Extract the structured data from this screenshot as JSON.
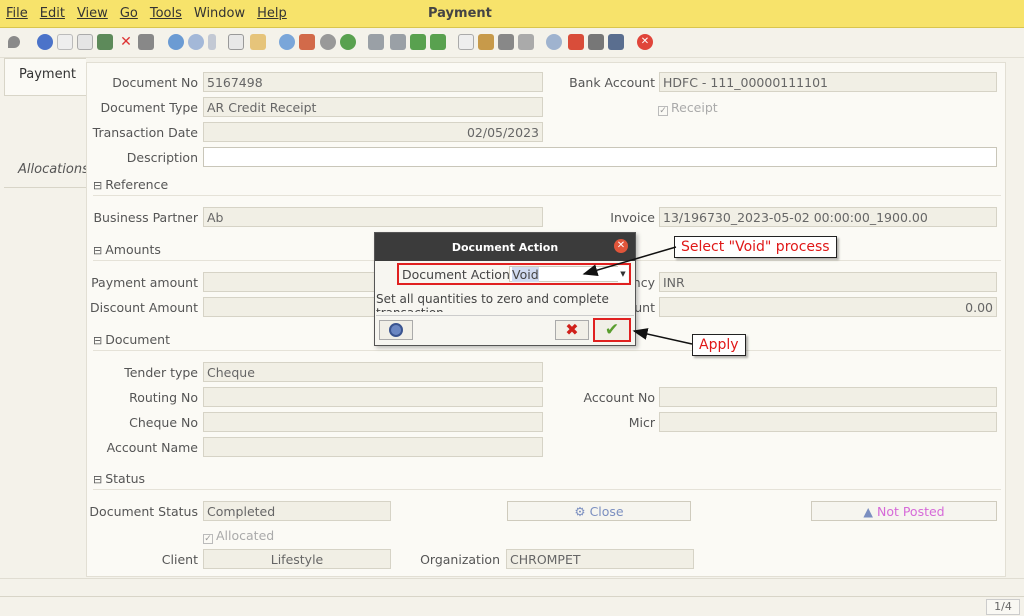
{
  "window": {
    "title": "Payment"
  },
  "menu": [
    "File",
    "Edit",
    "View",
    "Go",
    "Tools",
    "Window",
    "Help"
  ],
  "tabs": {
    "active": "Payment",
    "inactive": "Allocations"
  },
  "fields": {
    "document_no": {
      "label": "Document No",
      "value": "5167498"
    },
    "document_type": {
      "label": "Document Type",
      "value": "AR Credit Receipt"
    },
    "transaction_date": {
      "label": "Transaction Date",
      "value": "02/05/2023"
    },
    "description": {
      "label": "Description",
      "value": ""
    },
    "bank_account": {
      "label": "Bank Account",
      "value": "HDFC - 111_00000111101"
    },
    "receipt": {
      "label": "Receipt",
      "checked": true
    },
    "business_partner": {
      "label": "Business Partner",
      "value": "Ab"
    },
    "invoice": {
      "label": "Invoice",
      "value": "13/196730_2023-05-02 00:00:00_1900.00"
    },
    "payment_amount": {
      "label": "Payment amount",
      "value": ""
    },
    "discount_amount": {
      "label": "Discount Amount",
      "value": ""
    },
    "currency": {
      "label": "ncy",
      "value": "INR"
    },
    "write_off": {
      "label": "unt",
      "value": "0.00"
    },
    "tender_type": {
      "label": "Tender type",
      "value": "Cheque"
    },
    "routing_no": {
      "label": "Routing No",
      "value": ""
    },
    "account_no": {
      "label": "Account No",
      "value": ""
    },
    "cheque_no": {
      "label": "Cheque No",
      "value": ""
    },
    "micr": {
      "label": "Micr",
      "value": ""
    },
    "account_name": {
      "label": "Account Name",
      "value": ""
    },
    "document_status": {
      "label": "Document Status",
      "value": "Completed"
    },
    "allocated": {
      "label": "Allocated",
      "checked": true
    },
    "client": {
      "label": "Client",
      "value": "Lifestyle"
    },
    "organization": {
      "label": "Organization",
      "value": "CHROMPET"
    }
  },
  "sections": {
    "reference": "Reference",
    "amounts": "Amounts",
    "document": "Document",
    "status": "Status"
  },
  "buttons": {
    "close": "Close",
    "not_posted": "Not Posted"
  },
  "dialog": {
    "title": "Document Action",
    "field_label": "Document Action",
    "field_value": "Void",
    "help_text": "Set all quantities to zero and complete transaction"
  },
  "annotations": {
    "select_void": "Select \"Void\" process",
    "apply": "Apply"
  },
  "status": {
    "page": "1/4"
  },
  "colors": {
    "titlebar": "#f7e36b",
    "callout_text": "#e01818",
    "highlight_border": "#e02020"
  }
}
